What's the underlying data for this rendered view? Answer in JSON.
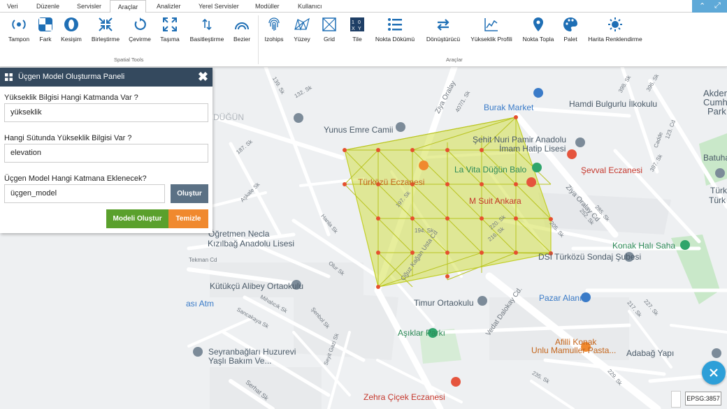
{
  "menu": {
    "tabs": [
      "Veri",
      "Düzenle",
      "Servisler",
      "Araçlar",
      "Analizler",
      "Yerel Servisler",
      "Modüller",
      "Kullanıcı"
    ],
    "active": "Araçlar"
  },
  "ribbon": {
    "spatial_tools": {
      "label": "Spatial Tools",
      "tools": [
        "Tampon",
        "Fark",
        "Kesişim",
        "Birleştirme",
        "Çevirme",
        "Taşıma",
        "Basitleştirme",
        "Bezier"
      ]
    },
    "araclar": {
      "label": "Araçlar",
      "tools": [
        "Izohips",
        "Yüzey",
        "Grid",
        "Tile",
        "Nokta Dökümü",
        "Dönüştürücü",
        "Yükseklik Profili",
        "Nokta Topla",
        "Palet",
        "Harita Renklendirme"
      ]
    },
    "accent_color": "#1f6fb5"
  },
  "panel": {
    "title": "Üçgen Model Oluşturma Paneli",
    "q1": "Yükseklik Bilgisi Hangi Katmanda Var ?",
    "v1": "yükseklik",
    "q2": "Hangi Sütunda Yükseklik Bilgisi Var ?",
    "v2": "elevation",
    "q3": "Üçgen Model Hangi Katmana Eklenecek?",
    "v3": "üçgen_model",
    "create_btn": "Oluştur",
    "model_btn": "Modeli Oluştur",
    "clear_btn": "Temizle",
    "header_color": "#34495e",
    "model_color": "#5aa02c",
    "clear_color": "#f0892e"
  },
  "map": {
    "labels": {
      "burak": "Burak Market",
      "hamdi": "Hamdi Bulgurlu İlkokulu",
      "akder": "Akder",
      "cumhur": "Cumhur",
      "park": "Park",
      "yunus": "Yunus Emre Camii",
      "sehit1": "Şehit Nuri Pamir Anadolu",
      "sehit2": "İmam Hatip Lisesi",
      "batuhan": "Batuhan",
      "lavita": "La Vita Düğün Balo",
      "sevval": "Şevval Eczanesi",
      "turkozu_ecz": "Türközü Eczanesi",
      "msuit": "M Suit Ankara",
      "turk1": "Türk",
      "turk2": "Türk ve",
      "ogretmen1": "Öğretmen Necla",
      "ogretmen2": "Kızılbağ Anadolu Lisesi",
      "konak": "Konak Halı Saha",
      "dsi": "DSİ Türközü Sondaj Şubesi",
      "kutukcu": "Kütükçü Alibey Ortaokulu",
      "atm": "ası Atm",
      "timur": "Timur Ortaokulu",
      "pazar": "Pazar Alanı",
      "asiklar": "Aşıklar Parkı",
      "afilli1": "Afilli Konak",
      "afilli2": "Unlu Mamuller Pasta...",
      "adabag": "Adabağ Yapı",
      "seyran1": "Seyranbağları Huzurevi",
      "seyran2": "Yaşlı Bakım Ve...",
      "zehra": "Zehra Çiçek Eczanesi",
      "dugun": "DÜĞÜN",
      "ziya1": "Ziya Oralay",
      "ziya2": "Ziya Oralay Cd",
      "vedat": "Vedat Dalokay Cd.",
      "oguz": "Oğuz Kağan Usta Cd",
      "serhat": "Serhat Sk",
      "s139": "139. Sk",
      "s132": "132. Sk",
      "s187": "187. Sk",
      "s407": "407/1. Sk",
      "s396": "396. Sk",
      "s397": "397. Sk",
      "s123": "123. Cd",
      "s398": "398. Sk",
      "caddle": "Cadde",
      "askale": "Aşkale Sk",
      "s197": "197. Sk",
      "s194": "194. Sk",
      "s220": "220. Sk",
      "s216": "216. Sk",
      "s205": "205. Sk",
      "s252": "252. Sk",
      "s285": "285. Sk",
      "hanla": "Hanla Sk",
      "olur": "Olur Sk",
      "tekman": "Tekman Cd",
      "mihalicik": "Mihalıcık Sk",
      "sancakaya": "Sancakaya Sk",
      "senbol": "Şenbol Sk",
      "seyit": "Seyit Gazi Sk",
      "s217": "217. Sk",
      "s227": "227. Sk",
      "s229": "229. Sk",
      "s235": "235. Sk"
    }
  },
  "epsg": "EPSG:3857"
}
